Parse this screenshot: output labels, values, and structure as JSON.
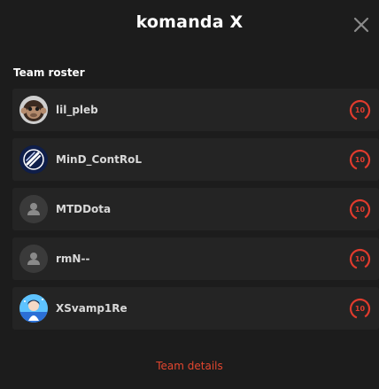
{
  "modal": {
    "title": "komanda X",
    "close_icon": "close-icon"
  },
  "roster": {
    "section_label": "Team roster",
    "players": [
      {
        "name": "lil_pleb",
        "level": "10",
        "avatar": "monkey-avatar"
      },
      {
        "name": "MinD_ContRoL",
        "level": "10",
        "avatar": "team-logo-avatar"
      },
      {
        "name": "MTDDota",
        "level": "10",
        "avatar": "default-user-avatar"
      },
      {
        "name": "rmN--",
        "level": "10",
        "avatar": "default-user-avatar"
      },
      {
        "name": "XSvamp1Re",
        "level": "10",
        "avatar": "anime-avatar"
      }
    ]
  },
  "footer": {
    "team_details_link": "Team details"
  },
  "colors": {
    "background": "#1c1c1c",
    "row_background": "#242424",
    "accent_red": "#e03b2d",
    "link_red": "#e4462f"
  }
}
